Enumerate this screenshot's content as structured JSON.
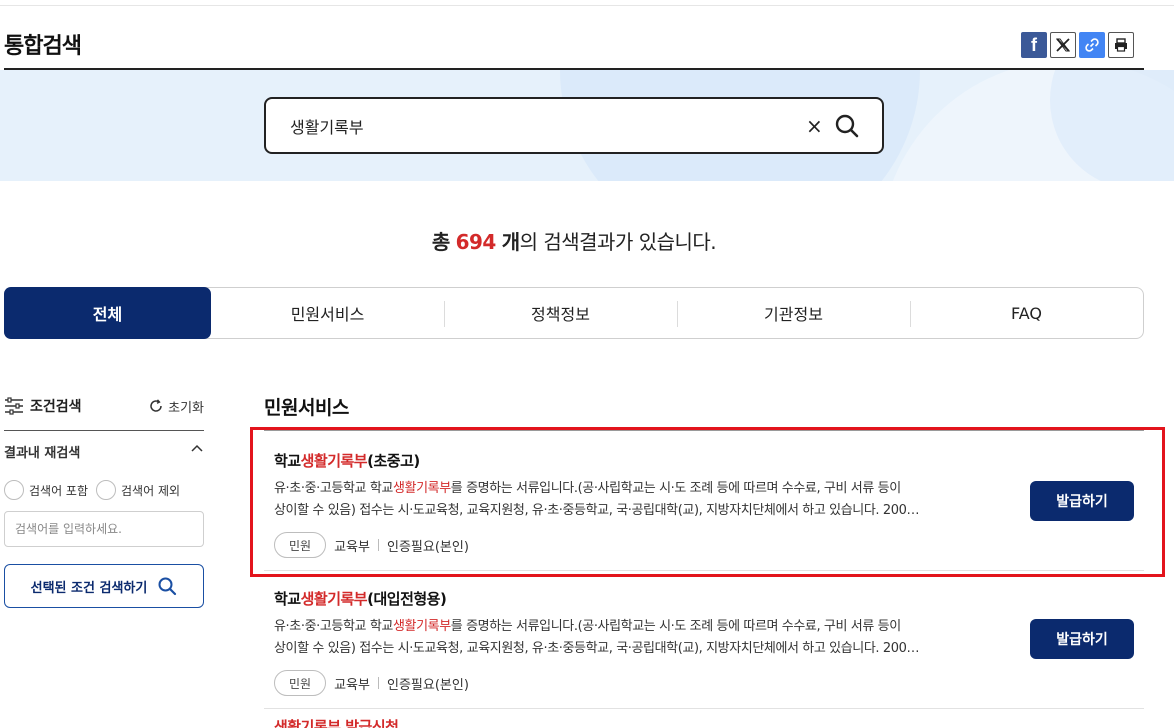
{
  "page": {
    "title": "통합검색"
  },
  "search": {
    "query": "생활기록부",
    "clear_label": "×"
  },
  "summary": {
    "prefix": "총",
    "count": "694",
    "unit": "개",
    "suffix": "의 검색결과가 있습니다."
  },
  "tabs": [
    {
      "label": "전체",
      "active": true
    },
    {
      "label": "민원서비스",
      "active": false
    },
    {
      "label": "정책정보",
      "active": false
    },
    {
      "label": "기관정보",
      "active": false
    },
    {
      "label": "FAQ",
      "active": false
    }
  ],
  "sidebar": {
    "heading": "조건검색",
    "reset_label": "초기화",
    "refine_heading": "결과내 재검색",
    "include_label": "검색어 포함",
    "exclude_label": "검색어 제외",
    "input_placeholder": "검색어를 입력하세요.",
    "search_button_label": "선택된 조건 검색하기"
  },
  "section": {
    "title": "민원서비스"
  },
  "results": [
    {
      "title_before": "학교",
      "title_highlight": "생활기록부",
      "title_after": "(초중고)",
      "desc_line1_before": "유·초·중·고등학교 학교",
      "desc_line1_highlight": "생활기록부",
      "desc_line1_after": "를 증명하는 서류입니다.(공·사립학교는 시·도 조례 등에 따르며 수수료, 구비 서류 등이",
      "desc_line2": "상이할 수 있음) 접수는 시·도교육청, 교육지원청, 유·초·중등학교, 국·공립대학(교), 지방자치단체에서 하고 있습니다. 200…",
      "badge": "민원",
      "agency": "교육부",
      "auth": "인증필요(본인)",
      "button_label": "발급하기"
    },
    {
      "title_before": "학교",
      "title_highlight": "생활기록부",
      "title_after": "(대입전형용)",
      "desc_line1_before": "유·초·중·고등학교 학교",
      "desc_line1_highlight": "생활기록부",
      "desc_line1_after": "를 증명하는 서류입니다.(공·사립학교는 시·도 조례 등에 따르며 수수료, 구비 서류 등이",
      "desc_line2": "상이할 수 있음) 접수는 시·도교육청, 교육지원청, 유·초·중등학교, 국·공립대학(교), 지방자치단체에서 하고 있습니다. 200…",
      "badge": "민원",
      "agency": "교육부",
      "auth": "인증필요(본인)",
      "button_label": "발급하기"
    }
  ],
  "peek": {
    "text": "생활기록부 발급신청"
  },
  "colors": {
    "navy": "#0b2a6e",
    "highlight": "#d32a2a",
    "band": "#e6f1fb",
    "frame": "#e3141c"
  }
}
